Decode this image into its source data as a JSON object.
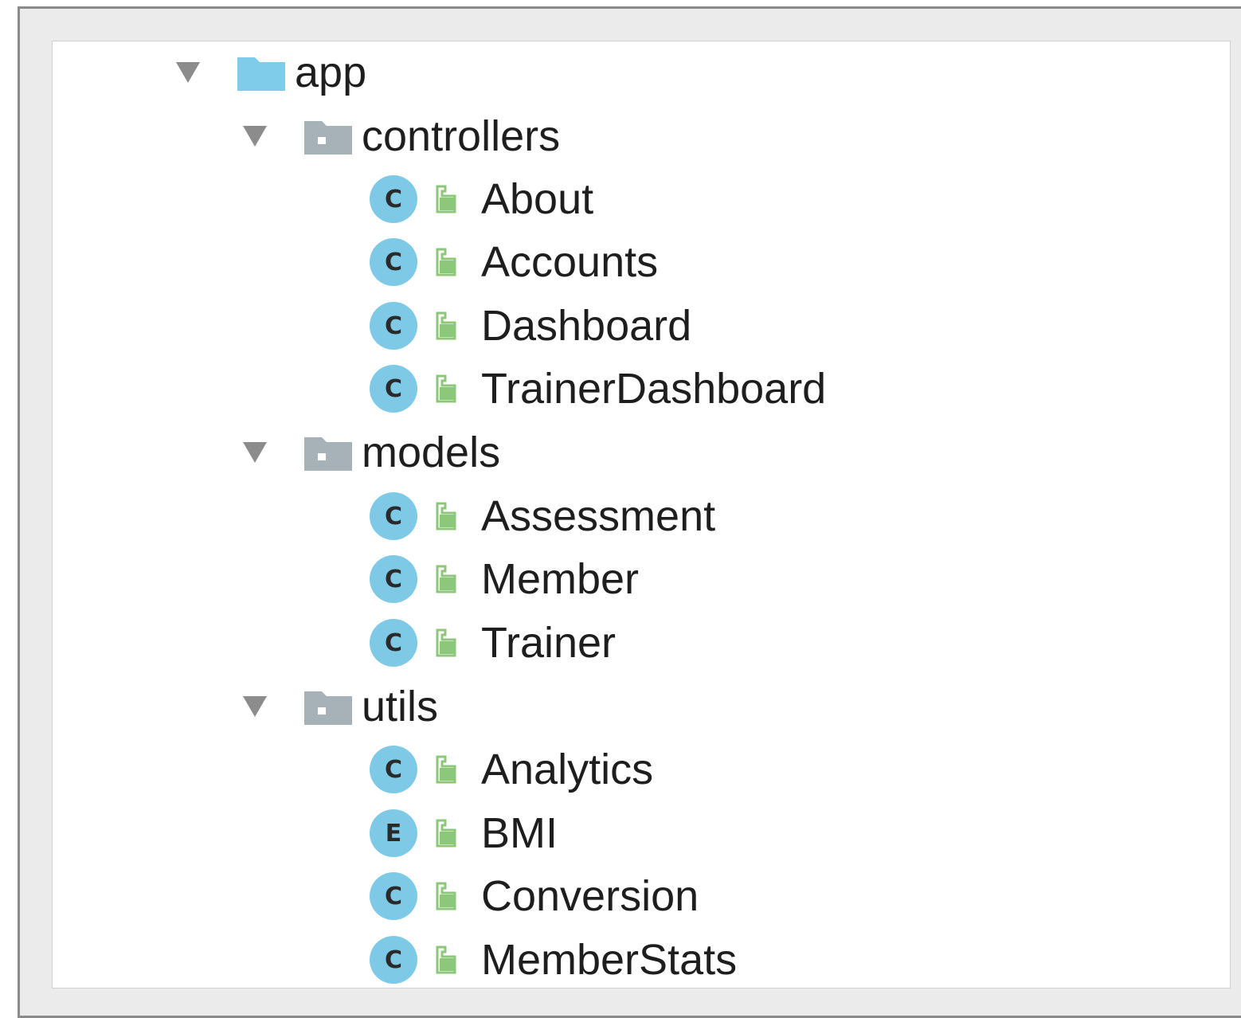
{
  "colors": {
    "class_circle": "#7ec9e6",
    "folder_blue": "#7ecbea",
    "folder_gray": "#a6b2b8",
    "lock_green": "#8cc77a",
    "arrow": "#8c8c8c"
  },
  "tree": {
    "root": {
      "label": "app",
      "icon": "folder-icon"
    },
    "controllers": {
      "label": "controllers",
      "items": [
        {
          "kind": "C",
          "label": "About"
        },
        {
          "kind": "C",
          "label": "Accounts"
        },
        {
          "kind": "C",
          "label": "Dashboard"
        },
        {
          "kind": "C",
          "label": "TrainerDashboard"
        }
      ]
    },
    "models": {
      "label": "models",
      "items": [
        {
          "kind": "C",
          "label": "Assessment"
        },
        {
          "kind": "C",
          "label": "Member"
        },
        {
          "kind": "C",
          "label": "Trainer"
        }
      ]
    },
    "utils": {
      "label": "utils",
      "items": [
        {
          "kind": "C",
          "label": "Analytics"
        },
        {
          "kind": "E",
          "label": "BMI"
        },
        {
          "kind": "C",
          "label": "Conversion"
        },
        {
          "kind": "C",
          "label": "MemberStats"
        }
      ]
    }
  }
}
